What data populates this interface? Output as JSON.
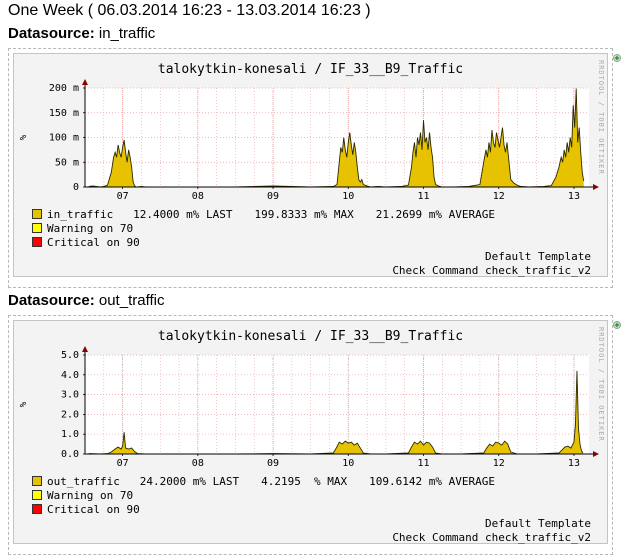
{
  "page_title": "One Week ( 06.03.2014 16:23 - 13.03.2014 16:23 )",
  "datasource_label": "Datasource:",
  "graphs": [
    {
      "datasource": "in_traffic",
      "title": "talokytkin-konesali / IF_33__B9_Traffic",
      "y_unit": "%",
      "rrd_credit": "RRDTOOL / TOBI OETIKER",
      "legend": [
        {
          "color": "#e6c200",
          "label": "in_traffic",
          "gap": "   ",
          "cur": "12.4000 m% LAST",
          "max": "199.8333 m% MAX",
          "avg": "21.2699 m% AVERAGE"
        },
        {
          "color": "#ffff00",
          "label": "Warning on 70"
        },
        {
          "color": "#ff0000",
          "label": "Critical on 90"
        }
      ],
      "footer_template": "Default Template",
      "footer_command": "Check Command check_traffic_v2"
    },
    {
      "datasource": "out_traffic",
      "title": "talokytkin-konesali / IF_33__B9_Traffic",
      "y_unit": "%",
      "rrd_credit": "RRDTOOL / TOBI OETIKER",
      "legend": [
        {
          "color": "#e6c200",
          "label": "out_traffic",
          "gap": "   ",
          "cur": "24.2000 m% LAST",
          "max": "4.2195  % MAX",
          "avg": "109.6142 m% AVERAGE"
        },
        {
          "color": "#ffff00",
          "label": "Warning on 70"
        },
        {
          "color": "#ff0000",
          "label": "Critical on 90"
        }
      ],
      "footer_template": "Default Template",
      "footer_command": "Check Command check_traffic_v2"
    }
  ],
  "chart_data": [
    {
      "type": "area",
      "title": "talokytkin-konesali / IF_33__B9_Traffic",
      "ylabel": "%",
      "ylim": [
        0,
        0.2
      ],
      "y_ticks": [
        0,
        0.05,
        0.1,
        0.15,
        0.2
      ],
      "y_tick_labels": [
        "0",
        "50 m",
        "100 m",
        "150 m",
        "200 m"
      ],
      "xlim": [
        6.5,
        13.2
      ],
      "x_ticks": [
        7,
        8,
        9,
        10,
        11,
        12,
        13
      ],
      "x_tick_labels": [
        "07",
        "08",
        "09",
        "10",
        "11",
        "12",
        "13"
      ],
      "grid": true,
      "series": [
        {
          "name": "in_traffic",
          "color": "#e6c200",
          "x": [
            6.55,
            6.6,
            6.7,
            6.75,
            6.8,
            6.85,
            6.88,
            6.9,
            6.92,
            6.94,
            6.96,
            6.98,
            7.0,
            7.02,
            7.04,
            7.06,
            7.08,
            7.1,
            7.12,
            7.14,
            7.16,
            7.18,
            7.2,
            7.25,
            7.3,
            7.5,
            8.0,
            8.5,
            9.0,
            9.5,
            9.8,
            9.85,
            9.88,
            9.9,
            9.92,
            9.94,
            9.96,
            9.98,
            10.0,
            10.02,
            10.04,
            10.06,
            10.08,
            10.1,
            10.12,
            10.14,
            10.16,
            10.18,
            10.2,
            10.25,
            10.3,
            10.4,
            10.5,
            10.7,
            10.8,
            10.84,
            10.86,
            10.88,
            10.9,
            10.92,
            10.94,
            10.96,
            10.98,
            11.0,
            11.02,
            11.04,
            11.06,
            11.08,
            11.1,
            11.12,
            11.14,
            11.16,
            11.2,
            11.25,
            11.4,
            11.6,
            11.75,
            11.8,
            11.83,
            11.85,
            11.87,
            11.89,
            11.91,
            11.93,
            11.95,
            11.97,
            11.99,
            12.01,
            12.03,
            12.05,
            12.07,
            12.09,
            12.11,
            12.13,
            12.16,
            12.2,
            12.25,
            12.3,
            12.4,
            12.6,
            12.7,
            12.76,
            12.8,
            12.83,
            12.85,
            12.87,
            12.89,
            12.91,
            12.93,
            12.95,
            12.97,
            12.99,
            13.01,
            13.03,
            13.05,
            13.07,
            13.09,
            13.11,
            13.13
          ],
          "values": [
            0.001,
            0.002,
            0.0,
            0.001,
            0.004,
            0.03,
            0.06,
            0.07,
            0.06,
            0.085,
            0.07,
            0.06,
            0.08,
            0.095,
            0.07,
            0.05,
            0.075,
            0.06,
            0.04,
            0.01,
            0.002,
            0.0,
            0.0,
            0.001,
            0.0,
            0.0,
            0.0,
            0.0,
            0.002,
            0.0,
            0.001,
            0.005,
            0.05,
            0.08,
            0.07,
            0.1,
            0.075,
            0.06,
            0.09,
            0.11,
            0.085,
            0.065,
            0.09,
            0.07,
            0.04,
            0.015,
            0.01,
            0.015,
            0.005,
            0.002,
            0.0,
            0.001,
            0.0,
            0.001,
            0.004,
            0.04,
            0.07,
            0.09,
            0.06,
            0.1,
            0.085,
            0.11,
            0.075,
            0.135,
            0.09,
            0.1,
            0.075,
            0.11,
            0.08,
            0.06,
            0.02,
            0.005,
            0.002,
            0.0,
            0.0,
            0.001,
            0.005,
            0.05,
            0.075,
            0.06,
            0.09,
            0.07,
            0.115,
            0.09,
            0.08,
            0.11,
            0.095,
            0.08,
            0.1,
            0.12,
            0.085,
            0.07,
            0.09,
            0.06,
            0.015,
            0.008,
            0.003,
            0.001,
            0.0,
            0.001,
            0.003,
            0.02,
            0.04,
            0.06,
            0.05,
            0.075,
            0.06,
            0.09,
            0.07,
            0.1,
            0.08,
            0.165,
            0.12,
            0.199,
            0.09,
            0.12,
            0.07,
            0.03,
            0.012
          ]
        }
      ],
      "warning_threshold": 0.07,
      "critical_threshold": 0.09
    },
    {
      "type": "area",
      "title": "talokytkin-konesali / IF_33__B9_Traffic",
      "ylabel": "%",
      "ylim": [
        0,
        5.0
      ],
      "y_ticks": [
        0,
        1,
        2,
        3,
        4,
        5
      ],
      "y_tick_labels": [
        "0.0",
        "1.0",
        "2.0",
        "3.0",
        "4.0",
        "5.0"
      ],
      "xlim": [
        6.5,
        13.2
      ],
      "x_ticks": [
        7,
        8,
        9,
        10,
        11,
        12,
        13
      ],
      "x_tick_labels": [
        "07",
        "08",
        "09",
        "10",
        "11",
        "12",
        "13"
      ],
      "grid": true,
      "series": [
        {
          "name": "out_traffic",
          "color": "#e6c200",
          "x": [
            6.55,
            6.7,
            6.8,
            6.85,
            6.9,
            6.94,
            6.98,
            7.0,
            7.02,
            7.04,
            7.08,
            7.12,
            7.16,
            7.2,
            7.3,
            7.5,
            8.0,
            8.5,
            9.0,
            9.5,
            9.8,
            9.84,
            9.88,
            9.92,
            9.96,
            10.0,
            10.04,
            10.08,
            10.12,
            10.16,
            10.2,
            10.3,
            10.5,
            10.8,
            10.84,
            10.88,
            10.92,
            10.96,
            11.0,
            11.04,
            11.08,
            11.12,
            11.16,
            11.25,
            11.5,
            11.8,
            11.84,
            11.88,
            11.92,
            11.96,
            12.0,
            12.04,
            12.08,
            12.12,
            12.16,
            12.25,
            12.5,
            12.8,
            12.84,
            12.88,
            12.92,
            12.96,
            13.0,
            13.02,
            13.04,
            13.06,
            13.08,
            13.1,
            13.12
          ],
          "values": [
            0.02,
            0.0,
            0.02,
            0.1,
            0.25,
            0.35,
            0.25,
            0.4,
            1.1,
            0.3,
            0.25,
            0.3,
            0.12,
            0.02,
            0.0,
            0.0,
            0.0,
            0.0,
            0.02,
            0.0,
            0.05,
            0.3,
            0.6,
            0.5,
            0.65,
            0.55,
            0.6,
            0.45,
            0.55,
            0.3,
            0.05,
            0.0,
            0.0,
            0.05,
            0.35,
            0.6,
            0.5,
            0.65,
            0.45,
            0.6,
            0.55,
            0.35,
            0.05,
            0.0,
            0.0,
            0.05,
            0.3,
            0.5,
            0.4,
            0.6,
            0.55,
            0.45,
            0.65,
            0.5,
            0.1,
            0.0,
            0.0,
            0.05,
            0.2,
            0.35,
            0.4,
            0.3,
            0.6,
            1.5,
            4.2,
            1.3,
            0.5,
            0.15,
            0.05
          ]
        }
      ]
    }
  ],
  "colors": {
    "area_fill": "#e6c200",
    "area_line": "#2a2a00",
    "grid": "#e8a0a0",
    "axis": "#000000"
  },
  "icons": [
    "graph-side-icon"
  ]
}
